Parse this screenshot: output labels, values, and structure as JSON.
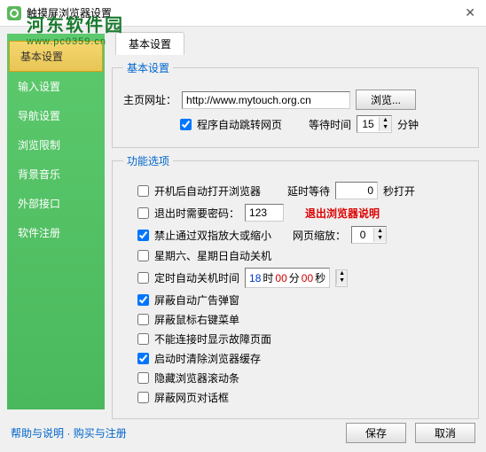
{
  "window": {
    "title": "触摸屏浏览器设置",
    "close": "✕"
  },
  "watermark": {
    "line1": "河东软件园",
    "line2": "www.pc0359.cn"
  },
  "sidebar": {
    "items": [
      {
        "label": "基本设置"
      },
      {
        "label": "输入设置"
      },
      {
        "label": "导航设置"
      },
      {
        "label": "浏览限制"
      },
      {
        "label": "背景音乐"
      },
      {
        "label": "外部接口"
      },
      {
        "label": "软件注册"
      }
    ]
  },
  "tab": {
    "label": "基本设置"
  },
  "basic": {
    "legend": "基本设置",
    "homepage_label": "主页网址：",
    "homepage_value": "http://www.mytouch.org.cn",
    "browse_btn": "浏览...",
    "auto_jump": "程序自动跳转网页",
    "wait_label": "等待时间",
    "wait_value": "15",
    "wait_unit": "分钟"
  },
  "func": {
    "legend": "功能选项",
    "auto_open": "开机后自动打开浏览器",
    "delay_label": "延时等待",
    "delay_value": "0",
    "delay_unit": "秒打开",
    "exit_pwd": "退出时需要密码：",
    "exit_pwd_value": "123",
    "exit_note": "退出浏览器说明",
    "no_pinch": "禁止通过双指放大或缩小",
    "zoom_label": "网页缩放：",
    "zoom_value": "0",
    "weekend_off": "星期六、星期日自动关机",
    "timed_off": "定时自动关机时间",
    "time_h": "18",
    "time_h_lbl": "时",
    "time_m": "00",
    "time_m_lbl": "分",
    "time_s": "00",
    "time_s_lbl": "秒",
    "block_popup": "屏蔽自动广告弹窗",
    "block_rclick": "屏蔽鼠标右键菜单",
    "no_fault": "不能连接时显示故障页面",
    "clear_cache": "启动时清除浏览器缓存",
    "hide_scroll": "隐藏浏览器滚动条",
    "block_dialog": "屏蔽网页对话框"
  },
  "footer": {
    "help": "帮助与说明",
    "sep": " · ",
    "buy": "购买与注册",
    "save": "保存",
    "cancel": "取消"
  }
}
